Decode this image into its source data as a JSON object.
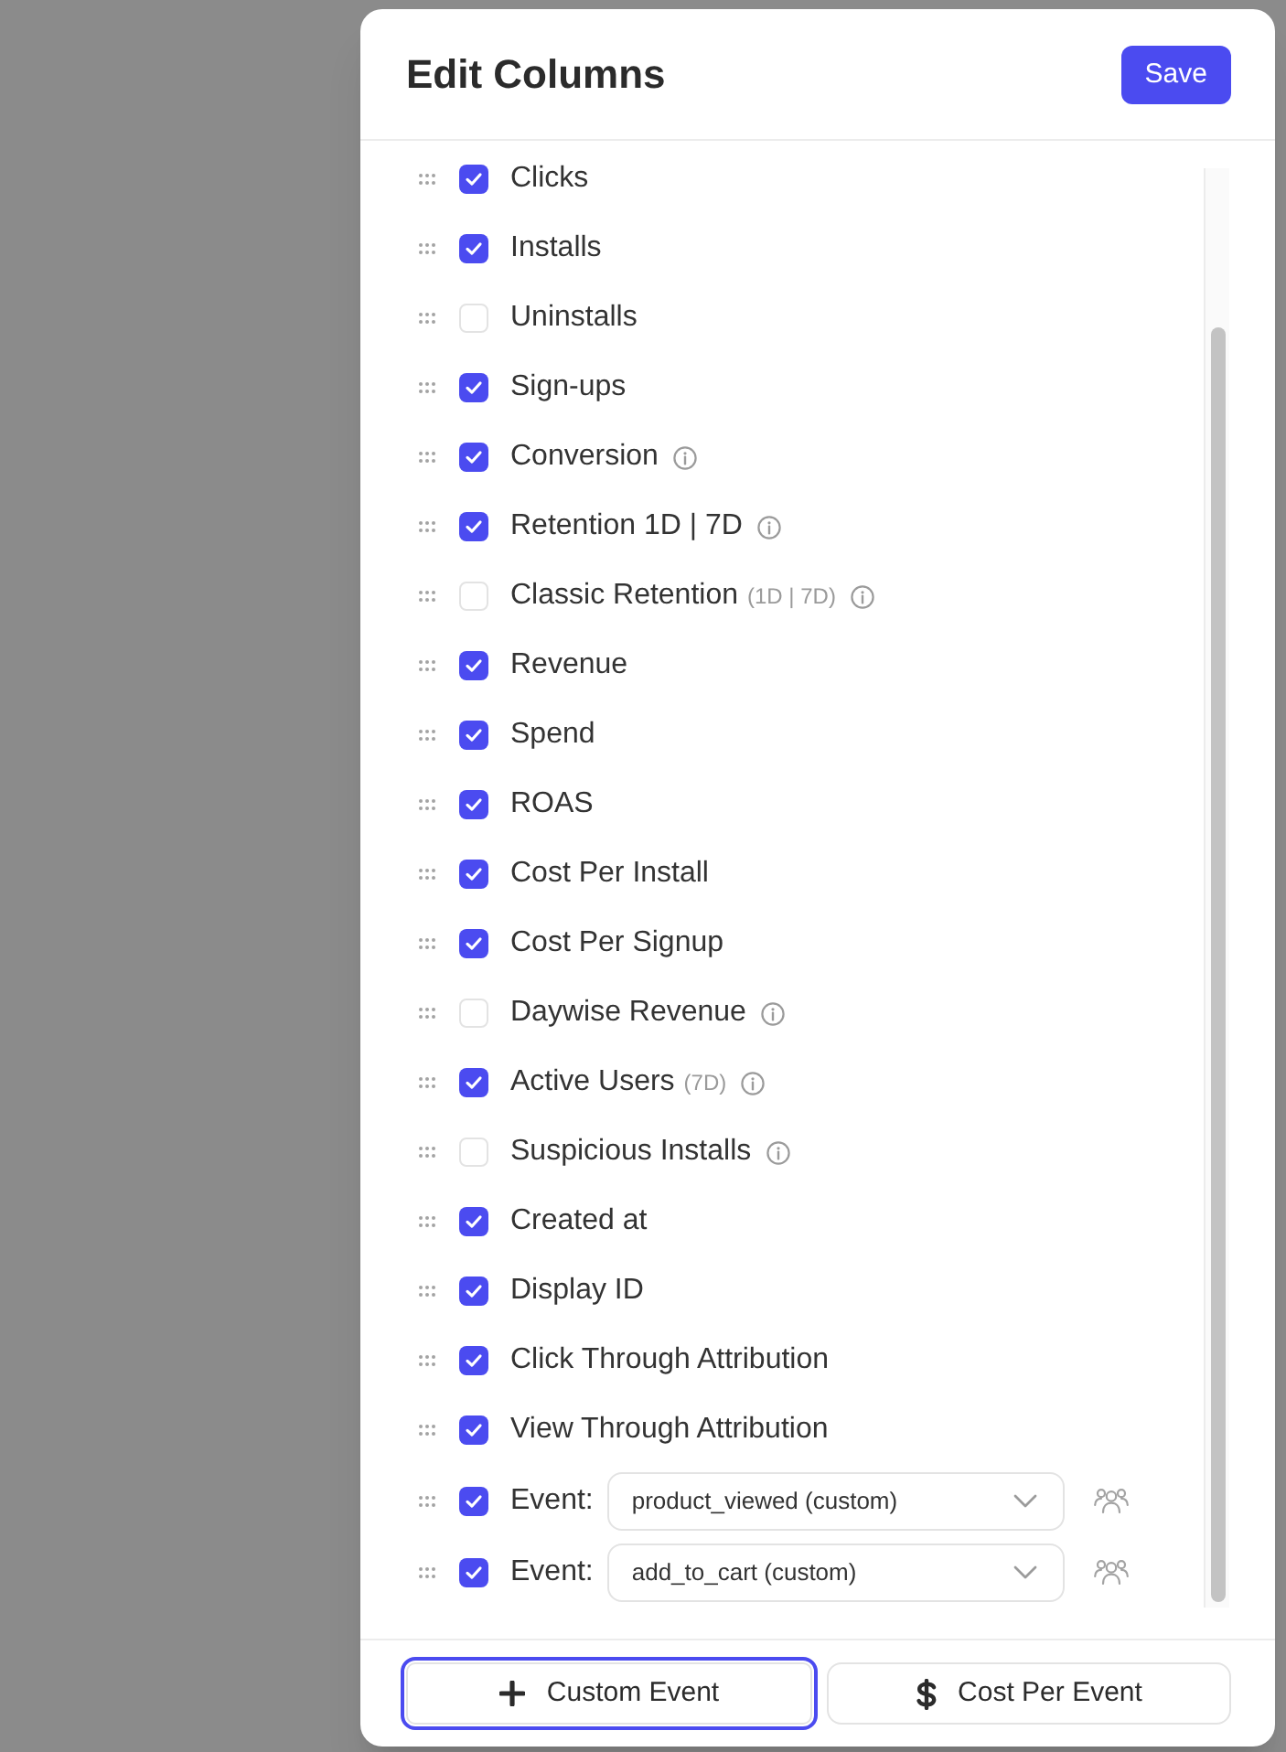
{
  "dialog": {
    "title": "Edit Columns",
    "save_button": "Save"
  },
  "columns": [
    {
      "kind": "metric",
      "label": "Clicks",
      "checked": true,
      "info": false
    },
    {
      "kind": "metric",
      "label": "Installs",
      "checked": true,
      "info": false
    },
    {
      "kind": "metric",
      "label": "Uninstalls",
      "checked": false,
      "info": false
    },
    {
      "kind": "metric",
      "label": "Sign-ups",
      "checked": true,
      "info": false
    },
    {
      "kind": "metric",
      "label": "Conversion",
      "checked": true,
      "info": true
    },
    {
      "kind": "metric",
      "label": "Retention 1D | 7D",
      "checked": true,
      "info": true
    },
    {
      "kind": "metric",
      "label": "Classic Retention",
      "suffix": "(1D | 7D)",
      "checked": false,
      "info": true
    },
    {
      "kind": "metric",
      "label": "Revenue",
      "checked": true,
      "info": false
    },
    {
      "kind": "metric",
      "label": "Spend",
      "checked": true,
      "info": false
    },
    {
      "kind": "metric",
      "label": "ROAS",
      "checked": true,
      "info": false
    },
    {
      "kind": "metric",
      "label": "Cost Per Install",
      "checked": true,
      "info": false
    },
    {
      "kind": "metric",
      "label": "Cost Per Signup",
      "checked": true,
      "info": false
    },
    {
      "kind": "metric",
      "label": "Daywise Revenue",
      "checked": false,
      "info": true
    },
    {
      "kind": "metric",
      "label": "Active Users",
      "suffix": "(7D)",
      "checked": true,
      "info": true
    },
    {
      "kind": "metric",
      "label": "Suspicious Installs",
      "checked": false,
      "info": true
    },
    {
      "kind": "metric",
      "label": "Created at",
      "checked": true,
      "info": false
    },
    {
      "kind": "metric",
      "label": "Display ID",
      "checked": true,
      "info": false
    },
    {
      "kind": "metric",
      "label": "Click Through Attribution",
      "checked": true,
      "info": false
    },
    {
      "kind": "metric",
      "label": "View Through Attribution",
      "checked": true,
      "info": false
    },
    {
      "kind": "event",
      "label": "Event:",
      "checked": true,
      "value": "product_viewed (custom)"
    },
    {
      "kind": "event",
      "label": "Event:",
      "checked": true,
      "value": "add_to_cart (custom)"
    }
  ],
  "footer_buttons": [
    {
      "kind": "add",
      "label": "Custom Event",
      "focused": true
    },
    {
      "kind": "cost",
      "label": "Cost Per Event",
      "focused": false
    }
  ]
}
